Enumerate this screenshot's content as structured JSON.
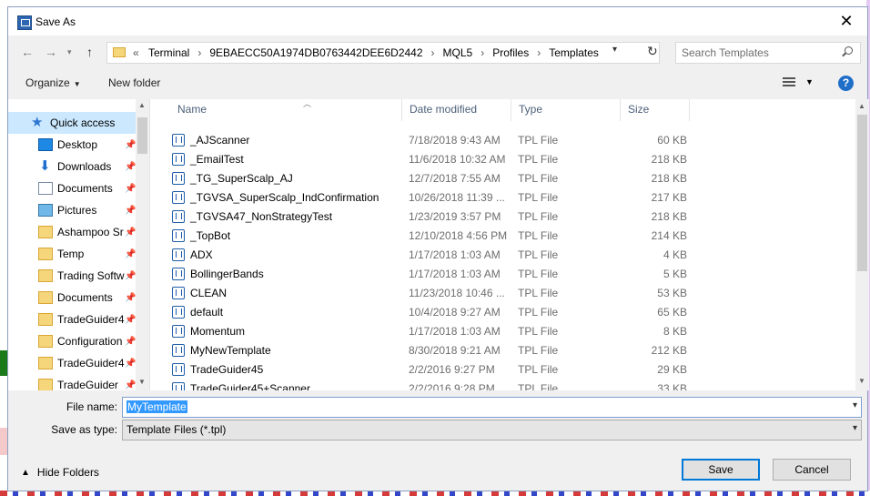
{
  "window": {
    "title": "Save As"
  },
  "address": {
    "prefix": "«",
    "crumbs": [
      "Terminal",
      "9EBAECC50A1974DB0763442DEE6D2442",
      "MQL5",
      "Profiles",
      "Templates"
    ]
  },
  "search": {
    "placeholder": "Search Templates"
  },
  "toolbar": {
    "organize_label": "Organize",
    "new_folder_label": "New folder",
    "help_label": "?"
  },
  "nav": {
    "items": [
      {
        "label": "Quick access",
        "icon": "star-icon",
        "pinned": false
      },
      {
        "label": "Desktop",
        "icon": "desktop-icon",
        "pinned": true
      },
      {
        "label": "Downloads",
        "icon": "download-icon",
        "pinned": true
      },
      {
        "label": "Documents",
        "icon": "documents-icon",
        "pinned": true
      },
      {
        "label": "Pictures",
        "icon": "pictures-icon",
        "pinned": true
      },
      {
        "label": "Ashampoo Sr",
        "icon": "folder-icon",
        "pinned": true
      },
      {
        "label": "Temp",
        "icon": "folder-icon",
        "pinned": true
      },
      {
        "label": "Trading Softw",
        "icon": "folder-icon",
        "pinned": true
      },
      {
        "label": "Documents",
        "icon": "folder-icon",
        "pinned": true
      },
      {
        "label": "TradeGuider4",
        "icon": "folder-icon",
        "pinned": true
      },
      {
        "label": "Configuration",
        "icon": "folder-icon",
        "pinned": true
      },
      {
        "label": "TradeGuider4",
        "icon": "folder-icon",
        "pinned": true
      },
      {
        "label": "TradeGuider",
        "icon": "folder-icon",
        "pinned": true
      }
    ]
  },
  "columns": {
    "name": "Name",
    "date": "Date modified",
    "type": "Type",
    "size": "Size"
  },
  "files": [
    {
      "name": "_AJScanner",
      "date": "7/18/2018 9:43 AM",
      "type": "TPL File",
      "size": "60 KB"
    },
    {
      "name": "_EmailTest",
      "date": "11/6/2018 10:32 AM",
      "type": "TPL File",
      "size": "218 KB"
    },
    {
      "name": "_TG_SuperScalp_AJ",
      "date": "12/7/2018 7:55 AM",
      "type": "TPL File",
      "size": "218 KB"
    },
    {
      "name": "_TGVSA_SuperScalp_IndConfirmation",
      "date": "10/26/2018 11:39 ...",
      "type": "TPL File",
      "size": "217 KB"
    },
    {
      "name": "_TGVSA47_NonStrategyTest",
      "date": "1/23/2019 3:57 PM",
      "type": "TPL File",
      "size": "218 KB"
    },
    {
      "name": "_TopBot",
      "date": "12/10/2018 4:56 PM",
      "type": "TPL File",
      "size": "214 KB"
    },
    {
      "name": "ADX",
      "date": "1/17/2018 1:03 AM",
      "type": "TPL File",
      "size": "4 KB"
    },
    {
      "name": "BollingerBands",
      "date": "1/17/2018 1:03 AM",
      "type": "TPL File",
      "size": "5 KB"
    },
    {
      "name": "CLEAN",
      "date": "11/23/2018 10:46 ...",
      "type": "TPL File",
      "size": "53 KB"
    },
    {
      "name": "default",
      "date": "10/4/2018 9:27 AM",
      "type": "TPL File",
      "size": "65 KB"
    },
    {
      "name": "Momentum",
      "date": "1/17/2018 1:03 AM",
      "type": "TPL File",
      "size": "8 KB"
    },
    {
      "name": "MyNewTemplate",
      "date": "8/30/2018 9:21 AM",
      "type": "TPL File",
      "size": "212 KB"
    },
    {
      "name": "TradeGuider45",
      "date": "2/2/2016 9:27 PM",
      "type": "TPL File",
      "size": "29 KB"
    },
    {
      "name": "TradeGuider45+Scanner",
      "date": "2/2/2016 9:28 PM",
      "type": "TPL File",
      "size": "33 KB"
    }
  ],
  "form": {
    "file_name_label": "File name:",
    "file_name_value": "MyTemplate",
    "save_type_label": "Save as type:",
    "save_type_value": "Template Files (*.tpl)"
  },
  "footer": {
    "hide_folders_label": "Hide Folders",
    "save_label": "Save",
    "cancel_label": "Cancel"
  },
  "colors": {
    "accent": "#0078d7",
    "selection": "#cce8ff",
    "folder": "#f5d67b"
  }
}
